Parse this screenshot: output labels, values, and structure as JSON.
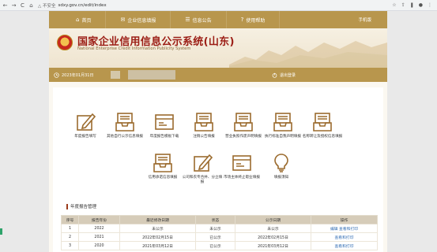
{
  "browser": {
    "back": "←",
    "forward": "→",
    "reload": "C",
    "home": "⌂",
    "security": "△ 不安全",
    "url": "sdxy.gov.cn/edit/index",
    "actions": [
      "☆",
      "⇪",
      "❚",
      "●",
      "⋮"
    ]
  },
  "nav": {
    "items": [
      {
        "icon": "⌂",
        "label": "首页"
      },
      {
        "icon": "✉",
        "label": "企业信息填报"
      },
      {
        "icon": "☰",
        "label": "信息公告"
      },
      {
        "icon": "?",
        "label": "使用帮助"
      }
    ],
    "mobile": "手机版"
  },
  "banner": {
    "title": "国家企业信用信息公示系统(山东)",
    "subtitle": "National Enterprise Credit Information Publicity System"
  },
  "infobar": {
    "date": "2023年01月31日",
    "logout": "退出登录"
  },
  "tiles": [
    {
      "label": "年度报告填写",
      "icon": "edit"
    },
    {
      "label": "其他自行公示信息填报",
      "icon": "tray"
    },
    {
      "label": "年度报告模板下载",
      "icon": "card"
    },
    {
      "label": "注销公告填报",
      "icon": "tray"
    },
    {
      "label": "营业执照作废声明填报",
      "icon": "tray"
    },
    {
      "label": "执行标准自我声明填报",
      "icon": "tray"
    },
    {
      "label": "名称转让及授权信息填报",
      "icon": "tray"
    },
    {
      "label": "信用承诺信息填报",
      "icon": "tray"
    },
    {
      "label": "公司和农专合并、分立填报",
      "icon": "edit"
    },
    {
      "label": "市场主体终止歇业填报",
      "icon": "card"
    },
    {
      "label": "填报须知",
      "icon": "bulb"
    }
  ],
  "section": {
    "title": "年度报告管理"
  },
  "table": {
    "headers": [
      "序号",
      "报告年份",
      "最近修改日期",
      "状态",
      "公示日期",
      "操作"
    ],
    "rows": [
      {
        "no": "1",
        "year": "2022",
        "modified": "未公示",
        "status": "未公示",
        "published": "未公示",
        "ops": "编辑  查看和打印"
      },
      {
        "no": "2",
        "year": "2021",
        "modified": "2022年02月15日",
        "status": "已公示",
        "published": "2022年02月15日",
        "ops": "查看和打印"
      },
      {
        "no": "3",
        "year": "2020",
        "modified": "2021年03月12日",
        "status": "已公示",
        "published": "2021年03月12日",
        "ops": "查看和打印"
      }
    ]
  },
  "colors": {
    "brand": "#b8964d",
    "title": "#9b1c14",
    "link": "#2f6bb3",
    "icon": "#9b6b2e"
  }
}
